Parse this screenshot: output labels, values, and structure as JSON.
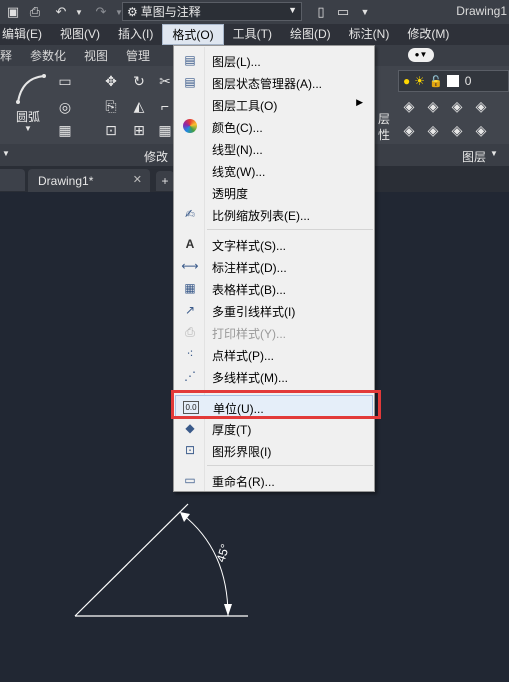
{
  "titlebar": {
    "workspace": "草图与注释",
    "title": "Drawing1"
  },
  "menubar": {
    "items": [
      "编辑(E)",
      "视图(V)",
      "插入(I)",
      "格式(O)",
      "工具(T)",
      "绘图(D)",
      "标注(N)",
      "修改(M)"
    ],
    "active": "格式(O)"
  },
  "ribbon": {
    "tabs": [
      "释",
      "参数化",
      "视图",
      "管理"
    ],
    "arc_label": "圆弧",
    "modify_label": "修改",
    "layer_label": "图层",
    "layer_label_partial": "层",
    "layer_label_partial2": "性",
    "layer_value": "0"
  },
  "doctabs": {
    "active": "Drawing1*",
    "close": "✕",
    "plus": "+"
  },
  "format_menu": {
    "items": [
      {
        "label": "图层(L)...",
        "icon": "layers-icon"
      },
      {
        "label": "图层状态管理器(A)...",
        "icon": "layer-state-icon"
      },
      {
        "label": "图层工具(O)",
        "icon": "",
        "submenu": "▶"
      },
      {
        "label": "颜色(C)...",
        "icon": "color-wheel-icon"
      },
      {
        "label": "线型(N)...",
        "icon": ""
      },
      {
        "label": "线宽(W)...",
        "icon": ""
      },
      {
        "label": "透明度",
        "icon": ""
      },
      {
        "label": "比例缩放列表(E)...",
        "icon": "scale-list-icon"
      },
      {
        "label": "文字样式(S)...",
        "icon": "text-style-icon"
      },
      {
        "label": "标注样式(D)...",
        "icon": "dim-style-icon"
      },
      {
        "label": "表格样式(B)...",
        "icon": "table-style-icon"
      },
      {
        "label": "多重引线样式(I)",
        "icon": "mleader-style-icon"
      },
      {
        "label": "打印样式(Y)...",
        "icon": "plot-style-icon",
        "disabled": true
      },
      {
        "label": "点样式(P)...",
        "icon": "point-style-icon"
      },
      {
        "label": "多线样式(M)...",
        "icon": "mline-style-icon"
      },
      {
        "label": "单位(U)...",
        "icon": "units-icon",
        "icon_text": "0.0"
      },
      {
        "label": "厚度(T)",
        "icon": "thickness-icon"
      },
      {
        "label": "图形界限(I)",
        "icon": "limits-icon"
      },
      {
        "label": "重命名(R)...",
        "icon": "rename-icon"
      }
    ]
  },
  "canvas": {
    "angle_label": "45°"
  }
}
